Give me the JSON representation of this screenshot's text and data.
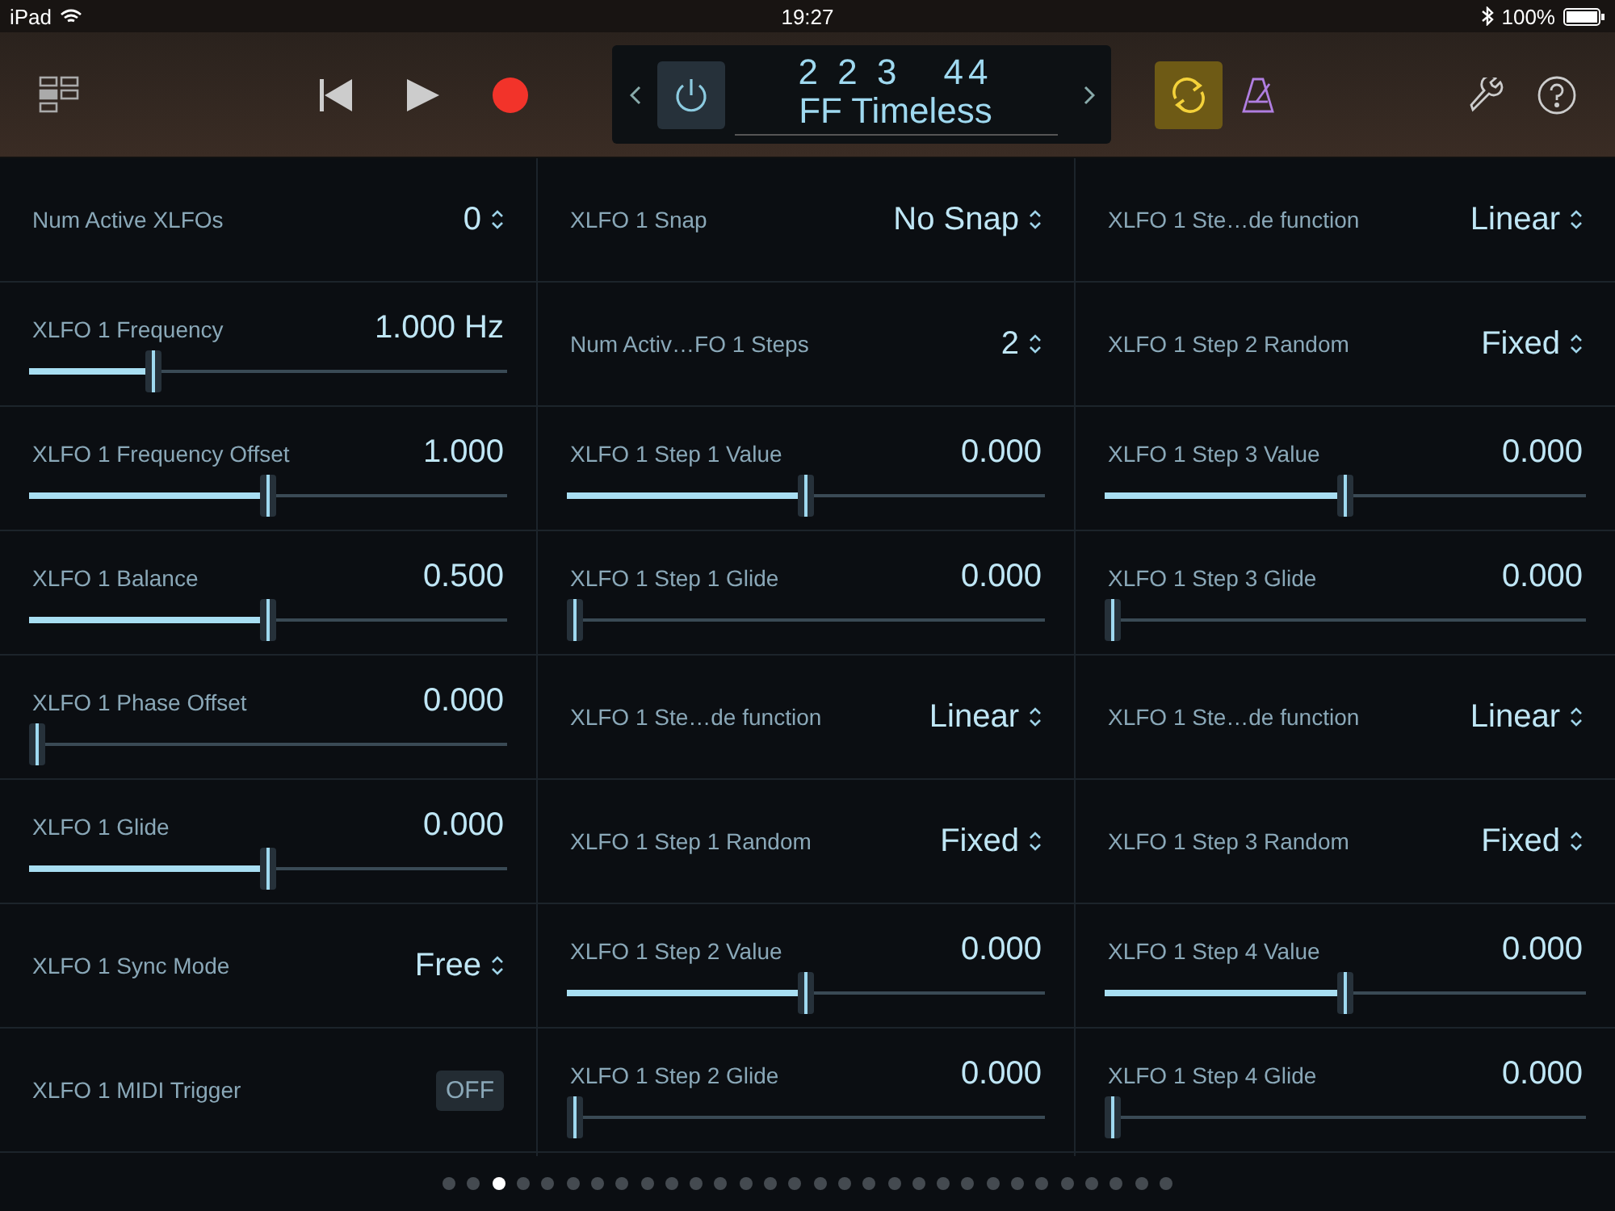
{
  "status_bar": {
    "device": "iPad",
    "time": "19:27",
    "battery": "100%"
  },
  "display": {
    "position": "2 2 3",
    "signature": "44",
    "patch": "FF Timeless"
  },
  "loop_on": true,
  "columns": [
    [
      {
        "kind": "menu",
        "label": "Num Active XLFOs",
        "value": "0"
      },
      {
        "kind": "slider",
        "label": "XLFO 1 Frequency",
        "value": "1.000 Hz",
        "level": 0.25
      },
      {
        "kind": "slider",
        "label": "XLFO 1 Frequency Offset",
        "value": "1.000",
        "level": 0.5
      },
      {
        "kind": "slider",
        "label": "XLFO 1 Balance",
        "value": "0.500",
        "level": 0.5
      },
      {
        "kind": "slider",
        "label": "XLFO 1 Phase Offset",
        "value": "0.000",
        "level": 0
      },
      {
        "kind": "slider",
        "label": "XLFO 1 Glide",
        "value": "0.000",
        "level": 0.5
      },
      {
        "kind": "menu",
        "label": "XLFO 1 Sync Mode",
        "value": "Free"
      },
      {
        "kind": "toggle",
        "label": "XLFO 1 MIDI Trigger",
        "value": "OFF",
        "on": false
      }
    ],
    [
      {
        "kind": "menu",
        "label": "XLFO 1 Snap",
        "value": "No Snap"
      },
      {
        "kind": "menu",
        "label": "Num Activ…FO 1 Steps",
        "value": "2"
      },
      {
        "kind": "slider",
        "label": "XLFO 1 Step 1 Value",
        "value": "0.000",
        "level": 0.5
      },
      {
        "kind": "slider",
        "label": "XLFO 1 Step 1 Glide",
        "value": "0.000",
        "level": 0
      },
      {
        "kind": "menu",
        "label": "XLFO 1 Ste…de function",
        "value": "Linear"
      },
      {
        "kind": "menu",
        "label": "XLFO 1 Step 1 Random",
        "value": "Fixed"
      },
      {
        "kind": "slider",
        "label": "XLFO 1 Step 2 Value",
        "value": "0.000",
        "level": 0.5
      },
      {
        "kind": "slider",
        "label": "XLFO 1 Step 2 Glide",
        "value": "0.000",
        "level": 0
      }
    ],
    [
      {
        "kind": "menu",
        "label": "XLFO 1 Ste…de function",
        "value": "Linear"
      },
      {
        "kind": "menu",
        "label": "XLFO 1 Step 2 Random",
        "value": "Fixed"
      },
      {
        "kind": "slider",
        "label": "XLFO 1 Step 3 Value",
        "value": "0.000",
        "level": 0.5
      },
      {
        "kind": "slider",
        "label": "XLFO 1 Step 3 Glide",
        "value": "0.000",
        "level": 0
      },
      {
        "kind": "menu",
        "label": "XLFO 1 Ste…de function",
        "value": "Linear"
      },
      {
        "kind": "menu",
        "label": "XLFO 1 Step 3 Random",
        "value": "Fixed"
      },
      {
        "kind": "slider",
        "label": "XLFO 1 Step 4 Value",
        "value": "0.000",
        "level": 0.5
      },
      {
        "kind": "slider",
        "label": "XLFO 1 Step 4 Glide",
        "value": "0.000",
        "level": 0
      }
    ]
  ],
  "pages": [
    {
      "selected": false
    },
    {
      "selected": false
    },
    {
      "selected": true
    },
    {
      "selected": false
    },
    {
      "selected": false
    },
    {
      "selected": false
    },
    {
      "selected": false
    },
    {
      "selected": false
    },
    {
      "selected": false
    },
    {
      "selected": false
    },
    {
      "selected": false
    },
    {
      "selected": false
    },
    {
      "selected": false
    },
    {
      "selected": false
    },
    {
      "selected": false
    },
    {
      "selected": false
    },
    {
      "selected": false
    },
    {
      "selected": false
    },
    {
      "selected": false
    },
    {
      "selected": false
    },
    {
      "selected": false
    },
    {
      "selected": false
    },
    {
      "selected": false
    },
    {
      "selected": false
    },
    {
      "selected": false
    },
    {
      "selected": false
    },
    {
      "selected": false
    },
    {
      "selected": false
    },
    {
      "selected": false
    },
    {
      "selected": false
    }
  ]
}
